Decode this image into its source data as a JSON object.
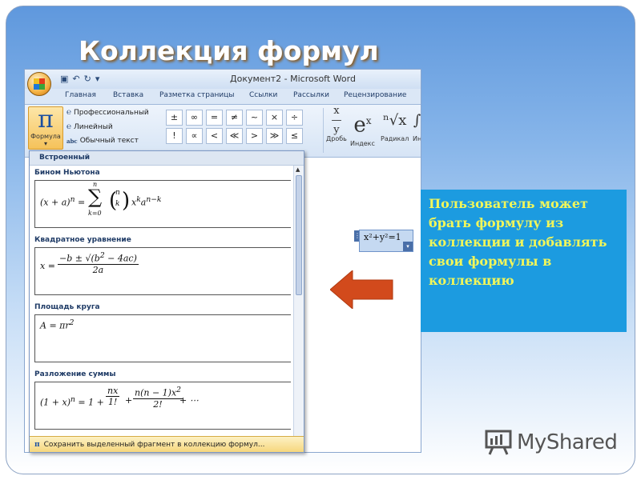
{
  "slide": {
    "title": "Коллекция формул",
    "callout_text": "Пользователь может брать формулу из коллекции и добавлять свои формулы в коллекцию"
  },
  "word": {
    "window_title": "Документ2 - Microsoft Word",
    "tabs": [
      "Главная",
      "Вставка",
      "Разметка страницы",
      "Ссылки",
      "Рассылки",
      "Рецензирование"
    ],
    "ribbon": {
      "formula_label": "Формула",
      "options": [
        "Профессиональный",
        "Линейный",
        "Обычный текст"
      ],
      "symbols_row1": [
        "±",
        "∞",
        "=",
        "≠",
        "~",
        "×",
        "÷"
      ],
      "symbols_row2": [
        "!",
        "∝",
        "<",
        "≪",
        ">",
        "≫",
        "≤"
      ],
      "structures": [
        "Дробь",
        "Индекс",
        "Радикал",
        "Ин"
      ]
    },
    "inline_equation": "x²+y²=1"
  },
  "gallery": {
    "header": "Встроенный",
    "items": [
      {
        "name": "Бином Ньютона"
      },
      {
        "name": "Квадратное уравнение"
      },
      {
        "name": "Площадь круга"
      },
      {
        "name": "Разложение суммы"
      }
    ],
    "footer": "Сохранить выделенный фрагмент в коллекцию формул..."
  },
  "watermark": "MyShared",
  "colors": {
    "callout_bg": "#1c9be0",
    "callout_text": "#f1f65a",
    "arrow": "#d24a1c"
  }
}
